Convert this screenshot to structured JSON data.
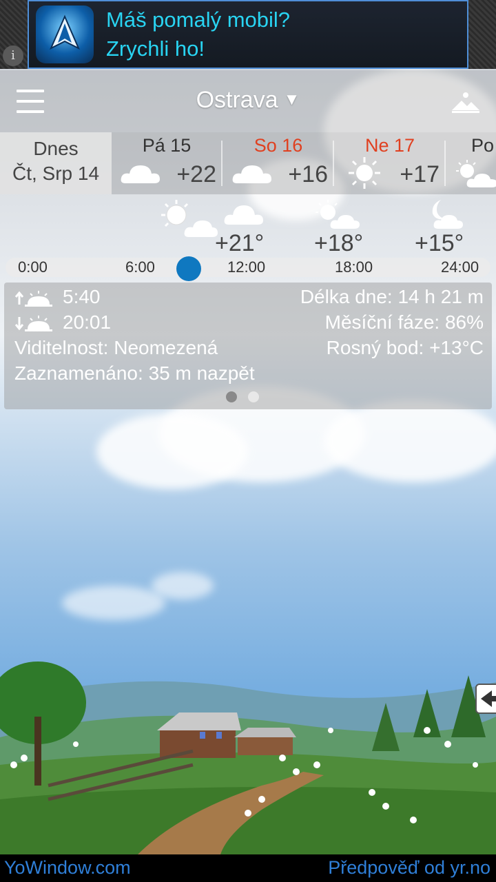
{
  "ad": {
    "line1": "Máš pomalý mobil?",
    "line2": "Zrychli ho!",
    "info_icon": "info-icon",
    "text_color": "#29d4f2"
  },
  "header": {
    "city": "Ostrava",
    "dropdown_arrow": "▼",
    "menu_icon": "hamburger-menu-icon",
    "landscape_icon": "mountain-landscape-icon"
  },
  "days": {
    "today": {
      "line1": "Dnes",
      "line2": "Čt, Srp 14"
    },
    "items": [
      {
        "name": "Pá 15",
        "temp": "+22",
        "icon": "cloud-icon",
        "weekend": false
      },
      {
        "name": "So 16",
        "temp": "+16",
        "icon": "cloud-icon",
        "weekend": true
      },
      {
        "name": "Ne 17",
        "temp": "+17",
        "icon": "sun-icon",
        "weekend": true
      },
      {
        "name": "Po",
        "temp": "",
        "icon": "sun-cloud-icon",
        "weekend": false
      }
    ],
    "weekend_color": "#e04020"
  },
  "hourly": {
    "temps": [
      "+21°",
      "+18°",
      "+15°"
    ],
    "icons": [
      "sun-cloud-icon",
      "cloud-icon",
      "sun-cloud-icon",
      "moon-cloud-icon"
    ],
    "ticks": [
      "0:00",
      "6:00",
      "12:00",
      "18:00",
      "24:00"
    ],
    "current_position_hours": 8.5,
    "knob_color": "#0f78c0"
  },
  "details": {
    "sunrise": "5:40",
    "sunset": "20:01",
    "day_length": "Délka dne: 14 h 21 m",
    "moon_phase": "Měsíční fáze: 86%",
    "visibility": "Viditelnost: Neomezená",
    "dew_point": "Rosný bod: +13°C",
    "recorded": "Zaznamenáno: 35 m nazpět",
    "page_index": 0,
    "page_count": 2
  },
  "footer": {
    "left": "YoWindow.com",
    "right": "Předpověď od yr.no",
    "link_color": "#2f7fd8"
  }
}
